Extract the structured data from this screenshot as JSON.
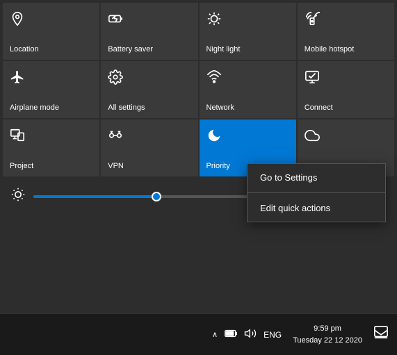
{
  "tiles": {
    "row1": [
      {
        "id": "location",
        "label": "Location",
        "icon": "📍",
        "active": false
      },
      {
        "id": "battery-saver",
        "label": "Battery saver",
        "icon": "🔋",
        "active": false
      },
      {
        "id": "night-light",
        "label": "Night light",
        "icon": "☀",
        "active": false
      },
      {
        "id": "mobile-hotspot",
        "label": "Mobile hotspot",
        "icon": "📶",
        "active": false
      }
    ],
    "row2": [
      {
        "id": "airplane-mode",
        "label": "Airplane mode",
        "icon": "✈",
        "active": false
      },
      {
        "id": "all-settings",
        "label": "All settings",
        "icon": "⚙",
        "active": false
      },
      {
        "id": "network",
        "label": "Network",
        "icon": "📡",
        "active": false
      },
      {
        "id": "connect",
        "label": "Connect",
        "icon": "🖥",
        "active": false
      }
    ],
    "row3": [
      {
        "id": "project",
        "label": "Project",
        "icon": "🖨",
        "active": false
      },
      {
        "id": "vpn",
        "label": "VPN",
        "icon": "♾",
        "active": false
      },
      {
        "id": "priority",
        "label": "Priority",
        "icon": "🌙",
        "active": true
      },
      {
        "id": "focus-assist",
        "label": "",
        "icon": "☁",
        "active": false
      }
    ]
  },
  "context_menu": {
    "items": [
      {
        "id": "go-to-settings",
        "label": "Go to Settings"
      },
      {
        "id": "edit-quick-actions",
        "label": "Edit quick actions"
      }
    ]
  },
  "brightness": {
    "value": 35,
    "icon": "☀"
  },
  "taskbar": {
    "time": "9:59 pm",
    "date": "Tuesday 22 12 2020",
    "lang": "ENG",
    "chevron": "∧",
    "battery_icon": "🔋",
    "sound_icon": "🔊",
    "notification_icon": "💬"
  }
}
